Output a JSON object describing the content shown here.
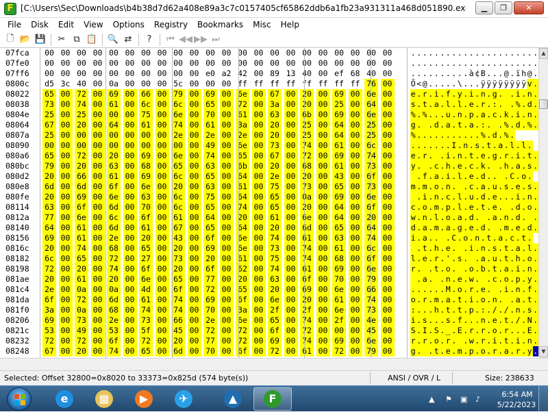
{
  "window": {
    "title": "[C:\\Users\\Sec\\Downloads\\b4b38d7d62a408e89a3c7c0157405cf65862ddb6a1fb23a931311a468d051890.exe] - Frhed",
    "app_icon_letter": "F",
    "minimize_glyph": "▁",
    "maximize_glyph": "❐",
    "close_glyph": "✕"
  },
  "menu": [
    "File",
    "Disk",
    "Edit",
    "View",
    "Options",
    "Registry",
    "Bookmarks",
    "Misc",
    "Help"
  ],
  "toolbar": [
    {
      "icon": "new-file-icon",
      "glyph": "🗋",
      "enabled": true
    },
    {
      "icon": "open-folder-icon",
      "glyph": "📂",
      "enabled": true
    },
    {
      "icon": "save-icon",
      "glyph": "💾",
      "enabled": true
    },
    {
      "sep": true
    },
    {
      "icon": "cut-icon",
      "glyph": "✂",
      "enabled": true
    },
    {
      "icon": "copy-icon",
      "glyph": "⧉",
      "enabled": true
    },
    {
      "icon": "paste-icon",
      "glyph": "📋",
      "enabled": true
    },
    {
      "sep": true
    },
    {
      "icon": "find-icon",
      "glyph": "🔍",
      "enabled": true
    },
    {
      "icon": "replace-icon",
      "glyph": "⇄",
      "enabled": true
    },
    {
      "sep": true
    },
    {
      "icon": "help-icon",
      "glyph": "?",
      "enabled": true
    },
    {
      "sep": true
    },
    {
      "icon": "first-bookmark-icon",
      "glyph": "⏮",
      "enabled": false
    },
    {
      "icon": "previous-bookmark-icon",
      "glyph": "◀◀",
      "enabled": false
    },
    {
      "icon": "next-bookmark-icon",
      "glyph": "▶▶",
      "enabled": false
    },
    {
      "icon": "last-bookmark-icon",
      "glyph": "⏭",
      "enabled": false
    }
  ],
  "hex": {
    "rows": [
      {
        "offset": "07fca",
        "bytes": "00 00 00 00 00 00 00 00 00 00 00 00 00 00 00 00 00 00 00 00 00 00",
        "ascii": "......................",
        "sel_from": 22
      },
      {
        "offset": "07fe0",
        "bytes": "00 00 00 00 00 00 00 00 00 00 00 00 00 00 00 00 00 00 00 00 00 00",
        "ascii": "......................",
        "sel_from": 22
      },
      {
        "offset": "07ff6",
        "bytes": "00 00 00 00 00 00 00 00 00 00 e0 a2 42 00 89 13 40 00 ef 68 40 00",
        "ascii": "..........à¢B...@.ïh@.",
        "sel_from": 22
      },
      {
        "offset": "0800c",
        "bytes": "d5 3c 40 00 0a 00 00 00 5c 00 00 00 ff ff ff ff ff ff ff ff 76 00",
        "ascii": "Õ<@.....\\...ÿÿÿÿÿÿÿÿv.",
        "sel_from": 20
      },
      {
        "offset": "08022",
        "bytes": "65 00 72 00 69 00 66 00 79 00 69 00 6e 00 67 00 20 00 69 00 6e 00",
        "ascii": "e.r.i.f.y.i.n.g. .i.n.",
        "sel_from": 0
      },
      {
        "offset": "08038",
        "bytes": "73 00 74 00 61 00 6c 00 6c 00 65 00 72 00 3a 00 20 00 25 00 64 00",
        "ascii": "s.t.a.l.l.e.r.:. .%.d.",
        "sel_from": 0
      },
      {
        "offset": "0804e",
        "bytes": "25 00 25 00 00 00 75 00 6e 00 70 00 61 00 63 00 6b 00 69 00 6e 00",
        "ascii": "%.%...u.n.p.a.c.k.i.n.",
        "sel_from": 0
      },
      {
        "offset": "08064",
        "bytes": "67 00 20 00 64 00 61 00 74 00 61 00 3a 00 20 00 25 00 64 00 25 00",
        "ascii": "g. .d.a.t.a.:. .%.d.%.",
        "sel_from": 0
      },
      {
        "offset": "0807a",
        "bytes": "25 00 00 00 00 00 00 00 2e 00 2e 00 2e 00 20 00 25 00 64 00 25 00",
        "ascii": "%...........%.d.%.",
        "sel_from": 0
      },
      {
        "offset": "08090",
        "bytes": "00 00 00 00 00 00 00 00 00 00 49 00 6e 00 73 00 74 00 61 00 6c 00",
        "ascii": ".......I.n.s.t.a.l.l.",
        "sel_from": 0
      },
      {
        "offset": "080a6",
        "bytes": "65 00 72 00 20 00 69 00 6e 00 74 00 65 00 67 00 72 00 69 00 74 00",
        "ascii": "e.r. .i.n.t.e.g.r.i.t.",
        "sel_from": 0
      },
      {
        "offset": "080bc",
        "bytes": "79 00 20 00 63 00 68 00 65 00 63 00 6b 00 20 00 68 00 61 00 73 00",
        "ascii": "y. .c.h.e.c.k. .h.a.s.",
        "sel_from": 0
      },
      {
        "offset": "080d2",
        "bytes": "20 00 66 00 61 00 69 00 6c 00 65 00 64 00 2e 00 20 00 43 00 6f 00",
        "ascii": " .f.a.i.l.e.d.. .C.o.",
        "sel_from": 0
      },
      {
        "offset": "080e8",
        "bytes": "6d 00 6d 00 6f 00 6e 00 20 00 63 00 61 00 75 00 73 00 65 00 73 00",
        "ascii": "m.m.o.n. .c.a.u.s.e.s.",
        "sel_from": 0
      },
      {
        "offset": "080fe",
        "bytes": "20 00 69 00 6e 00 63 00 6c 00 75 00 64 00 65 00 0a 00 69 00 6e 00",
        "ascii": " .i.n.c.l.u.d.e...i.n.",
        "sel_from": 0
      },
      {
        "offset": "08114",
        "bytes": "63 00 6f 00 6d 00 70 00 6c 00 65 00 74 00 65 00 20 00 64 00 6f 00",
        "ascii": "c.o.m.p.l.e.t.e. .d.o.",
        "sel_from": 0
      },
      {
        "offset": "0812a",
        "bytes": "77 00 6e 00 6c 00 6f 00 61 00 64 00 20 00 61 00 6e 00 64 00 20 00",
        "ascii": "w.n.l.o.a.d. .a.n.d. .",
        "sel_from": 0
      },
      {
        "offset": "08140",
        "bytes": "64 00 61 00 6d 00 61 00 67 00 65 00 64 00 20 00 6d 00 65 00 64 00",
        "ascii": "d.a.m.a.g.e.d. .m.e.d.",
        "sel_from": 0
      },
      {
        "offset": "08156",
        "bytes": "69 00 61 00 2e 00 20 00 43 00 6f 00 6e 00 74 00 61 00 63 00 74 00",
        "ascii": "i.a.. .C.o.n.t.a.c.t.",
        "sel_from": 0
      },
      {
        "offset": "0816c",
        "bytes": "20 00 74 00 68 00 65 00 20 00 69 00 6e 00 73 00 74 00 61 00 6c 00",
        "ascii": " .t.h.e. .i.n.s.t.a.l.",
        "sel_from": 0
      },
      {
        "offset": "08182",
        "bytes": "6c 00 65 00 72 00 27 00 73 00 20 00 61 00 75 00 74 00 68 00 6f 00",
        "ascii": "l.e.r.'.s. .a.u.t.h.o.",
        "sel_from": 0
      },
      {
        "offset": "08198",
        "bytes": "72 00 20 00 74 00 6f 00 20 00 6f 00 62 00 74 00 61 00 69 00 6e 00",
        "ascii": "r. .t.o. .o.b.t.a.i.n.",
        "sel_from": 0
      },
      {
        "offset": "081ae",
        "bytes": "20 00 61 00 20 00 6e 00 65 00 77 00 20 00 63 00 6f 00 70 00 79 00",
        "ascii": " .a. .n.e.w. .c.o.p.y.",
        "sel_from": 0
      },
      {
        "offset": "081c4",
        "bytes": "2e 00 0a 00 0a 00 4d 00 6f 00 72 00 65 00 20 00 69 00 6e 00 66 00",
        "ascii": "......M.o.r.e. .i.n.f.",
        "sel_from": 0
      },
      {
        "offset": "081da",
        "bytes": "6f 00 72 00 6d 00 61 00 74 00 69 00 6f 00 6e 00 20 00 61 00 74 00",
        "ascii": "o.r.m.a.t.i.o.n. .a.t.",
        "sel_from": 0
      },
      {
        "offset": "081f0",
        "bytes": "3a 00 0a 00 68 00 74 00 74 00 70 00 3a 00 2f 00 2f 00 6e 00 73 00",
        "ascii": ":...h.t.t.p.:././.n.s.",
        "sel_from": 0
      },
      {
        "offset": "08206",
        "bytes": "69 00 73 00 2e 00 73 00 66 00 2e 00 6e 00 65 00 74 00 2f 00 4e 00",
        "ascii": "i.s...s.f...n.e.t./.N.",
        "sel_from": 0
      },
      {
        "offset": "0821c",
        "bytes": "53 00 49 00 53 00 5f 00 45 00 72 00 72 00 6f 00 72 00 00 00 45 00",
        "ascii": "S.I.S._.E.r.r.o.r...E.",
        "sel_from": 0
      },
      {
        "offset": "08232",
        "bytes": "72 00 72 00 6f 00 72 00 20 00 77 00 72 00 69 00 74 00 69 00 6e 00",
        "ascii": "r.r.o.r. .w.r.i.t.i.n.",
        "sel_from": 0
      },
      {
        "offset": "08248",
        "bytes": "67 00 20 00 74 00 65 00 6d 00 70 00 6f 00 72 00 61 00 72 00 79 00",
        "ascii": "g. .t.e.m.p.o.r.a.r.y.",
        "sel_from": 0,
        "caret_at": 21
      }
    ]
  },
  "status": {
    "selection": "Selected: Offset 32800=0x8020 to 33373=0x825d (574 byte(s))",
    "mode": "ANSI / OVR / L",
    "size": "Size: 238633"
  },
  "taskbar": {
    "items": [
      {
        "name": "internet-explorer-icon",
        "glyph": "e",
        "color": "#1f8fe0"
      },
      {
        "name": "file-explorer-icon",
        "glyph": "▦",
        "color": "#e8c35a"
      },
      {
        "name": "media-player-icon",
        "glyph": "▶",
        "color": "#f07a22"
      },
      {
        "name": "app-compass-icon",
        "glyph": "✈",
        "color": "#2aa0e8"
      },
      {
        "name": "shark-app-icon",
        "glyph": "▲",
        "color": "#1f6fb0"
      },
      {
        "name": "frhed-taskbar-icon",
        "glyph": "F",
        "color": "#2e9a2e",
        "active": true
      }
    ],
    "tray_expand_glyph": "▲",
    "tray_icons": [
      "⚑",
      "▣",
      "♪"
    ],
    "time": "6:54 AM",
    "date": "5/22/2023"
  },
  "colors": {
    "selection_bg": "#ffff00",
    "caret_bg": "#0a0aa8",
    "taskbar": "#2b587f"
  }
}
